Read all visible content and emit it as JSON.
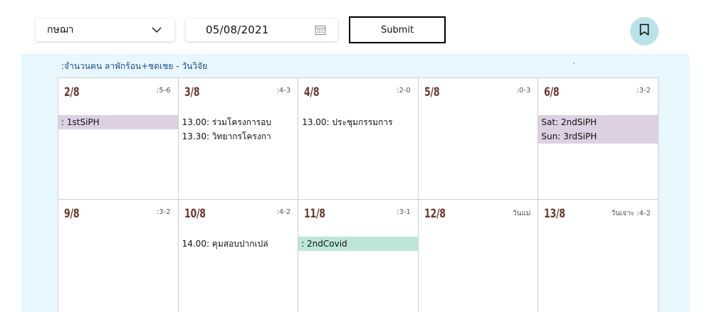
{
  "toolbar": {
    "month_label": "กษฌา",
    "date_value": "05/08/2021",
    "submit_label": "Submit"
  },
  "legend": ":จำนวนคน ลาพักร้อน+ชดเชย - วันวิจัย",
  "calendar": {
    "rows": [
      [
        {
          "day": "2/8",
          "meta": ":5-6",
          "events": [
            {
              "text": ": 1stSiPH",
              "style": "purple"
            }
          ]
        },
        {
          "day": "3/8",
          "meta": ":4-3",
          "events": [
            {
              "text": "13.00: ร่วมโครงการอบ",
              "style": "plain"
            },
            {
              "text": "13.30: วิทยากรโครงกา",
              "style": "plain"
            }
          ]
        },
        {
          "day": "4/8",
          "meta": ":2-0",
          "events": [
            {
              "text": "13.00: ประชุมกรรมการ",
              "style": "plain"
            }
          ]
        },
        {
          "day": "5/8",
          "meta": ":0-3",
          "events": []
        },
        {
          "day": "6/8",
          "meta": ":3-2",
          "events": [
            {
              "text": "Sat: 2ndSiPH",
              "style": "purple"
            },
            {
              "text": "Sun: 3rdSiPH",
              "style": "purple"
            }
          ]
        }
      ],
      [
        {
          "day": "9/8",
          "meta": ":3-2",
          "events": []
        },
        {
          "day": "10/8",
          "meta": ":4-2",
          "events": [
            {
              "text": "14.00: คุมสอบปากเปล่",
              "style": "plain"
            }
          ]
        },
        {
          "day": "11/8",
          "meta": ":3-1",
          "events": [
            {
              "text": ": 2ndCovid",
              "style": "green"
            }
          ]
        },
        {
          "day": "12/8",
          "meta": "วันแม่",
          "events": []
        },
        {
          "day": "13/8",
          "meta": "วันเจาะ :4-2",
          "events": []
        }
      ]
    ]
  },
  "colors": {
    "panel_bg": "#e8f6fd",
    "event_purple": "#dcd0e2",
    "event_green": "#bde6d6",
    "day_number": "#6b3a2e",
    "bookmark_bg": "#b9e3e8"
  },
  "icons": {
    "month_dropdown": "chevron-down-icon",
    "date_picker": "calendar-icon",
    "bookmark": "bookmark-icon"
  }
}
